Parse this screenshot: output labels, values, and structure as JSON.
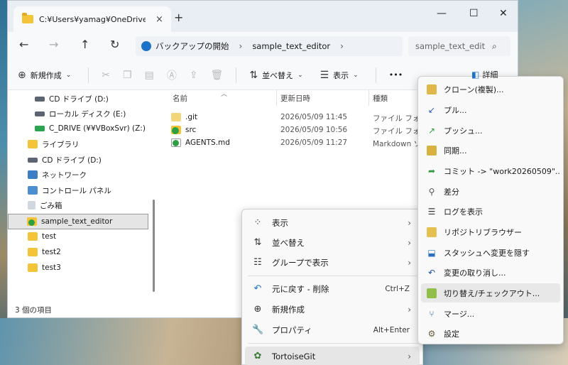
{
  "window": {
    "tab_title": "C:¥Users¥yamag¥OneDrive¥デ",
    "tab_close": "×",
    "new_tab": "+",
    "minimize": "—",
    "maximize": "☐",
    "close": "✕"
  },
  "nav_buttons": {
    "back": "←",
    "forward": "→",
    "up": "↑",
    "refresh": "↻"
  },
  "address": {
    "crumbs": [
      "バックアップの開始",
      "sample_text_editor"
    ],
    "sep": "›"
  },
  "search": {
    "placeholder": "sample_text_edit",
    "icon": "⌕"
  },
  "toolbar": {
    "new_label": "新規作成",
    "sort_label": "並べ替え",
    "view_label": "表示",
    "more": "•••",
    "details_label": "詳細"
  },
  "navpane": {
    "items": [
      {
        "label": "CD ドライブ (D:)",
        "icon": "cd-drive-icon"
      },
      {
        "label": "ローカル ディスク (E:)",
        "icon": "drive-icon"
      },
      {
        "label": "C_DRIVE (¥¥VBoxSvr) (Z:)",
        "icon": "network-drive-icon"
      },
      {
        "label": "ライブラリ",
        "icon": "library-icon"
      },
      {
        "label": "CD ドライブ (D:)",
        "icon": "cd-drive-icon"
      },
      {
        "label": "ネットワーク",
        "icon": "network-icon"
      },
      {
        "label": "コントロール パネル",
        "icon": "control-panel-icon"
      },
      {
        "label": "ごみ箱",
        "icon": "recycle-bin-icon"
      },
      {
        "label": "sample_text_editor",
        "icon": "git-folder-icon"
      },
      {
        "label": "test",
        "icon": "folder-icon"
      },
      {
        "label": "test2",
        "icon": "folder-icon"
      },
      {
        "label": "test3",
        "icon": "folder-icon"
      }
    ]
  },
  "columns": {
    "name": "名前",
    "modified": "更新日時",
    "type": "種類"
  },
  "files": [
    {
      "name": ".git",
      "modified": "2026/05/09 11:45",
      "type": "ファイル フォルダー"
    },
    {
      "name": "src",
      "modified": "2026/05/09 10:56",
      "type": "ファイル フォルダー"
    },
    {
      "name": "AGENTS.md",
      "modified": "2026/05/09 11:27",
      "type": "Markdown ソース"
    }
  ],
  "status": {
    "count": "3 個の項目"
  },
  "context_menu": {
    "view": "表示",
    "sort": "並べ替え",
    "group": "グループで表示",
    "undo": "元に戻す - 削除",
    "undo_shortcut": "Ctrl+Z",
    "new": "新規作成",
    "properties": "プロパティ",
    "properties_shortcut": "Alt+Enter",
    "tortoisegit": "TortoiseGit",
    "arrow": "›"
  },
  "submenu": {
    "items": [
      {
        "label": "クローン(複製)...",
        "icon": "clone-icon"
      },
      {
        "label": "プル...",
        "icon": "pull-icon"
      },
      {
        "label": "プッシュ...",
        "icon": "push-icon"
      },
      {
        "label": "同期...",
        "icon": "sync-icon"
      },
      {
        "label": "コミット -> \"work20260509\"...",
        "icon": "commit-icon"
      },
      {
        "label": "差分",
        "icon": "diff-icon"
      },
      {
        "label": "ログを表示",
        "icon": "log-icon"
      },
      {
        "label": "リポジトリブラウザー",
        "icon": "repo-browser-icon"
      },
      {
        "label": "スタッシュへ変更を隠す",
        "icon": "stash-icon"
      },
      {
        "label": "変更の取り消し...",
        "icon": "revert-icon"
      },
      {
        "label": "切り替え/チェックアウト...",
        "icon": "switch-checkout-icon"
      },
      {
        "label": "マージ...",
        "icon": "merge-icon"
      },
      {
        "label": "設定",
        "icon": "settings-icon"
      }
    ]
  }
}
